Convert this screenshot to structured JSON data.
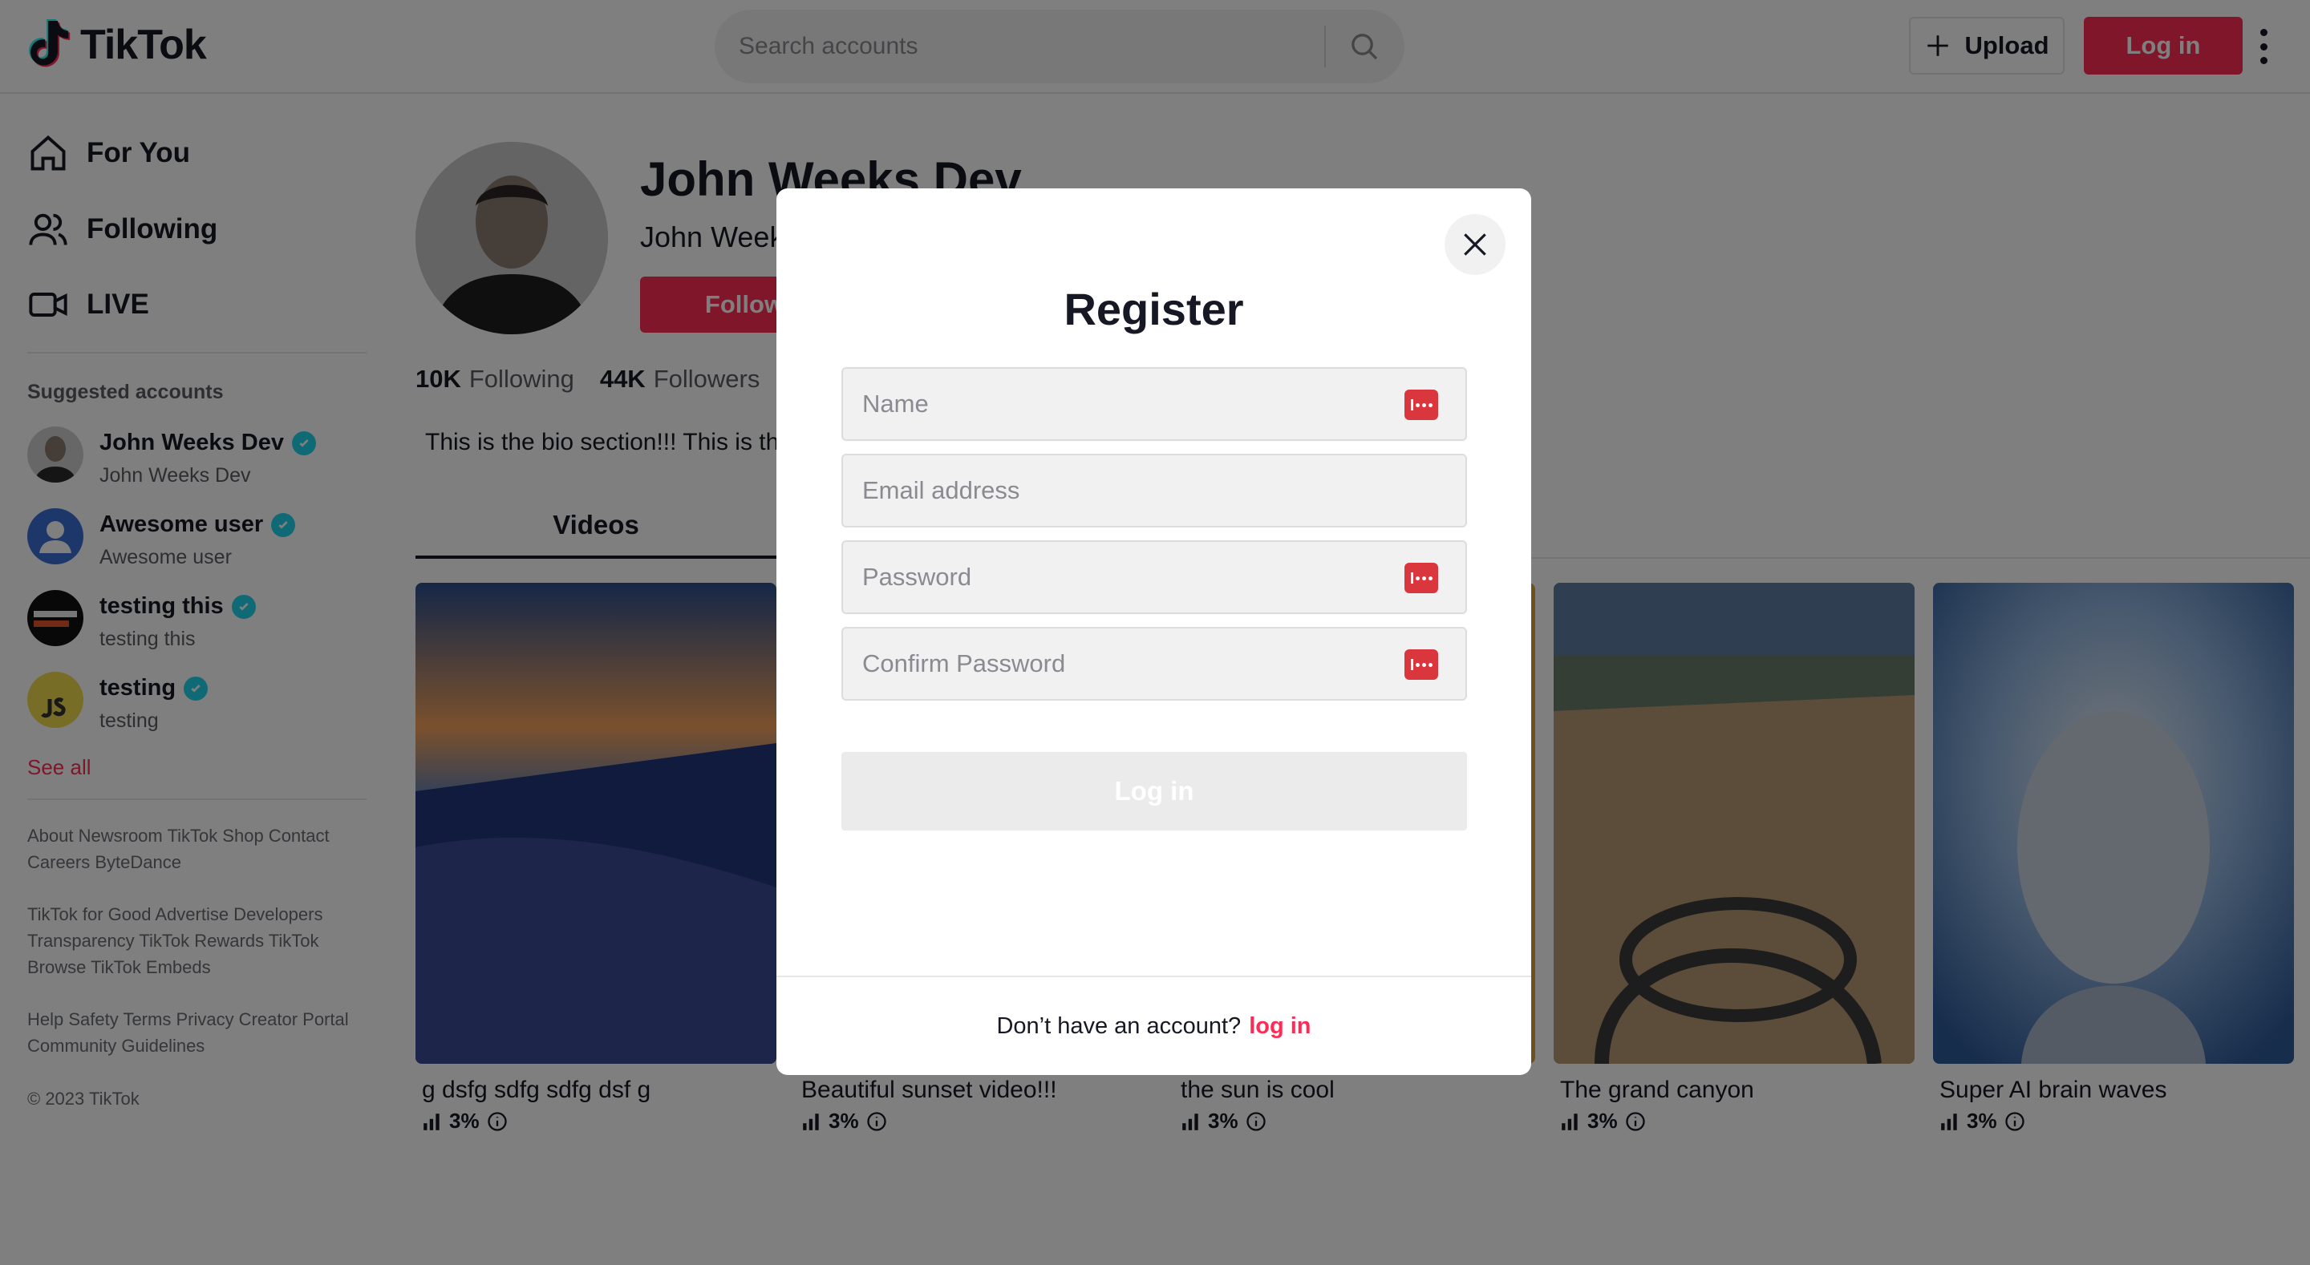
{
  "brand": {
    "name": "TikTok"
  },
  "header": {
    "search_placeholder": "Search accounts",
    "upload_label": "Upload",
    "login_label": "Log in"
  },
  "sidebar": {
    "nav": [
      {
        "label": "For You",
        "icon": "home-icon"
      },
      {
        "label": "Following",
        "icon": "users-icon"
      },
      {
        "label": "LIVE",
        "icon": "video-camera-icon"
      }
    ],
    "suggested_title": "Suggested accounts",
    "accounts": [
      {
        "name": "John Weeks Dev",
        "handle": "John Weeks Dev"
      },
      {
        "name": "Awesome user",
        "handle": "Awesome user"
      },
      {
        "name": "testing this",
        "handle": "testing this"
      },
      {
        "name": "testing",
        "handle": "testing"
      }
    ],
    "see_all": "See all",
    "footer": [
      "About Newsroom TikTok Shop Contact Careers ByteDance",
      "TikTok for Good Advertise Developers Transparency TikTok Rewards TikTok Browse TikTok Embeds",
      "Help Safety Terms Privacy Creator Portal Community Guidelines",
      "© 2023 TikTok"
    ]
  },
  "profile": {
    "title": "John Weeks Dev",
    "subtitle": "John Weeks Dev",
    "follow_label": "Follow",
    "following_count": "10K",
    "following_label": "Following",
    "followers_count": "44K",
    "followers_label": "Followers",
    "bio": "This is the bio section!!! This is the bio section!!!",
    "tab": "Videos"
  },
  "videos": [
    {
      "title": "g dsfg sdfg sdfg dsf g",
      "views": "3%"
    },
    {
      "title": "Beautiful sunset video!!!",
      "views": "3%"
    },
    {
      "title": "the sun is cool",
      "views": "3%"
    },
    {
      "title": "The grand canyon",
      "views": "3%"
    },
    {
      "title": "Super AI brain waves",
      "views": "3%"
    }
  ],
  "modal": {
    "title": "Register",
    "name_placeholder": "Name",
    "email_placeholder": "Email address",
    "password_placeholder": "Password",
    "confirm_placeholder": "Confirm Password",
    "submit_label": "Log in",
    "footer_text": "Don’t have an account?",
    "footer_link": "log in"
  },
  "colors": {
    "accent": "#fe2c55",
    "verified": "#20d5ec"
  }
}
